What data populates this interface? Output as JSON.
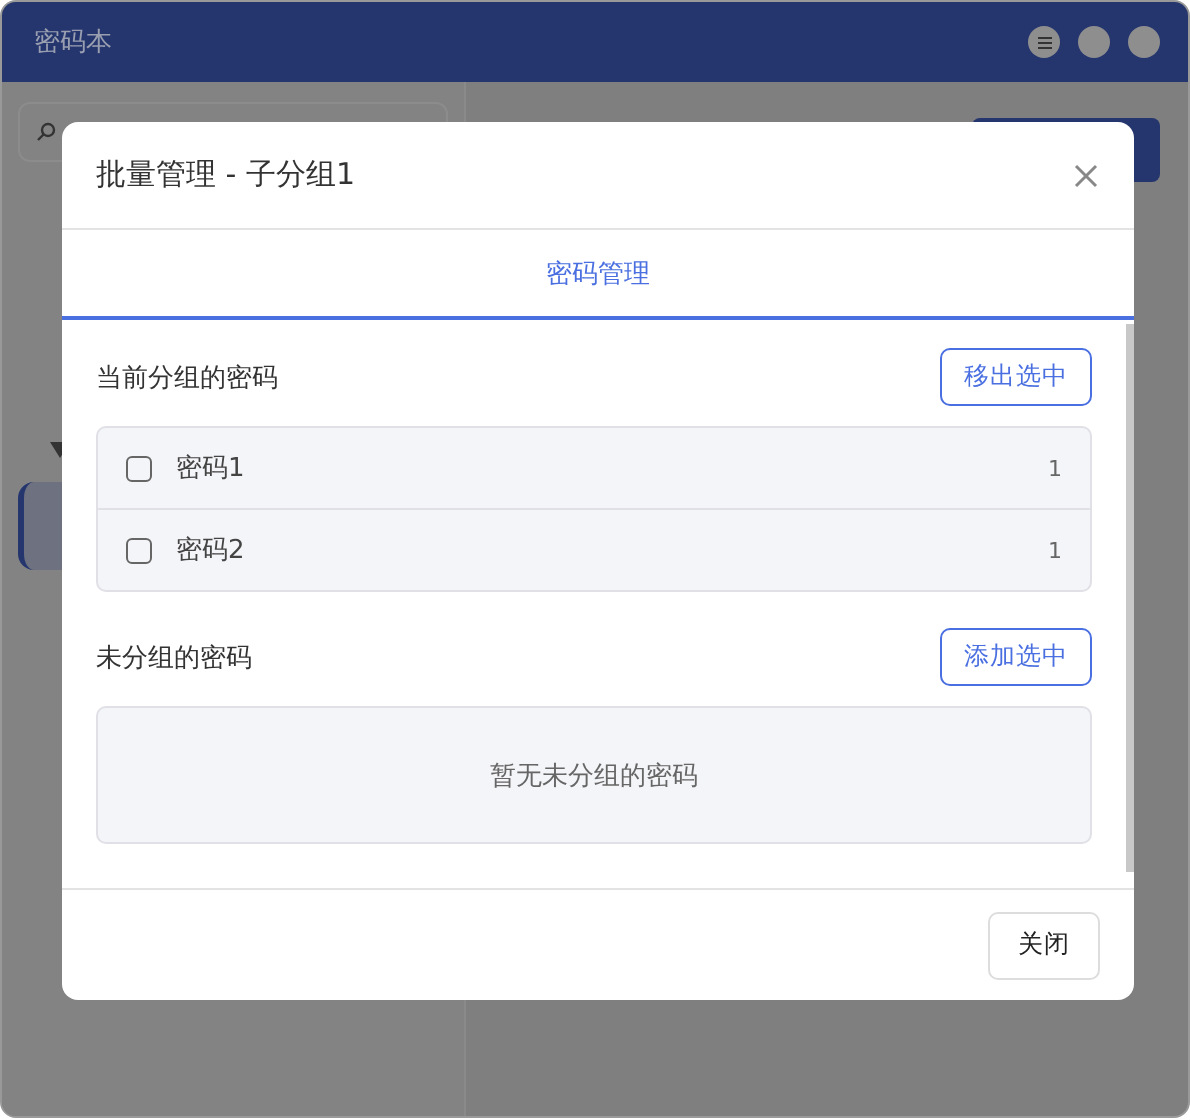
{
  "window": {
    "title": "密码本"
  },
  "dialog": {
    "title": "批量管理 - 子分组1",
    "tabs": [
      {
        "label": "密码管理",
        "selected": true
      }
    ],
    "sections": [
      {
        "heading": "当前分组的密码",
        "action": "移出选中",
        "items": [
          {
            "name": "密码1",
            "count": "1",
            "checked": false
          },
          {
            "name": "密码2",
            "count": "1",
            "checked": false
          }
        ]
      },
      {
        "heading": "未分组的密码",
        "action": "添加选中",
        "empty_text": "暂无未分组的密码"
      }
    ],
    "footer_button": "关闭"
  }
}
